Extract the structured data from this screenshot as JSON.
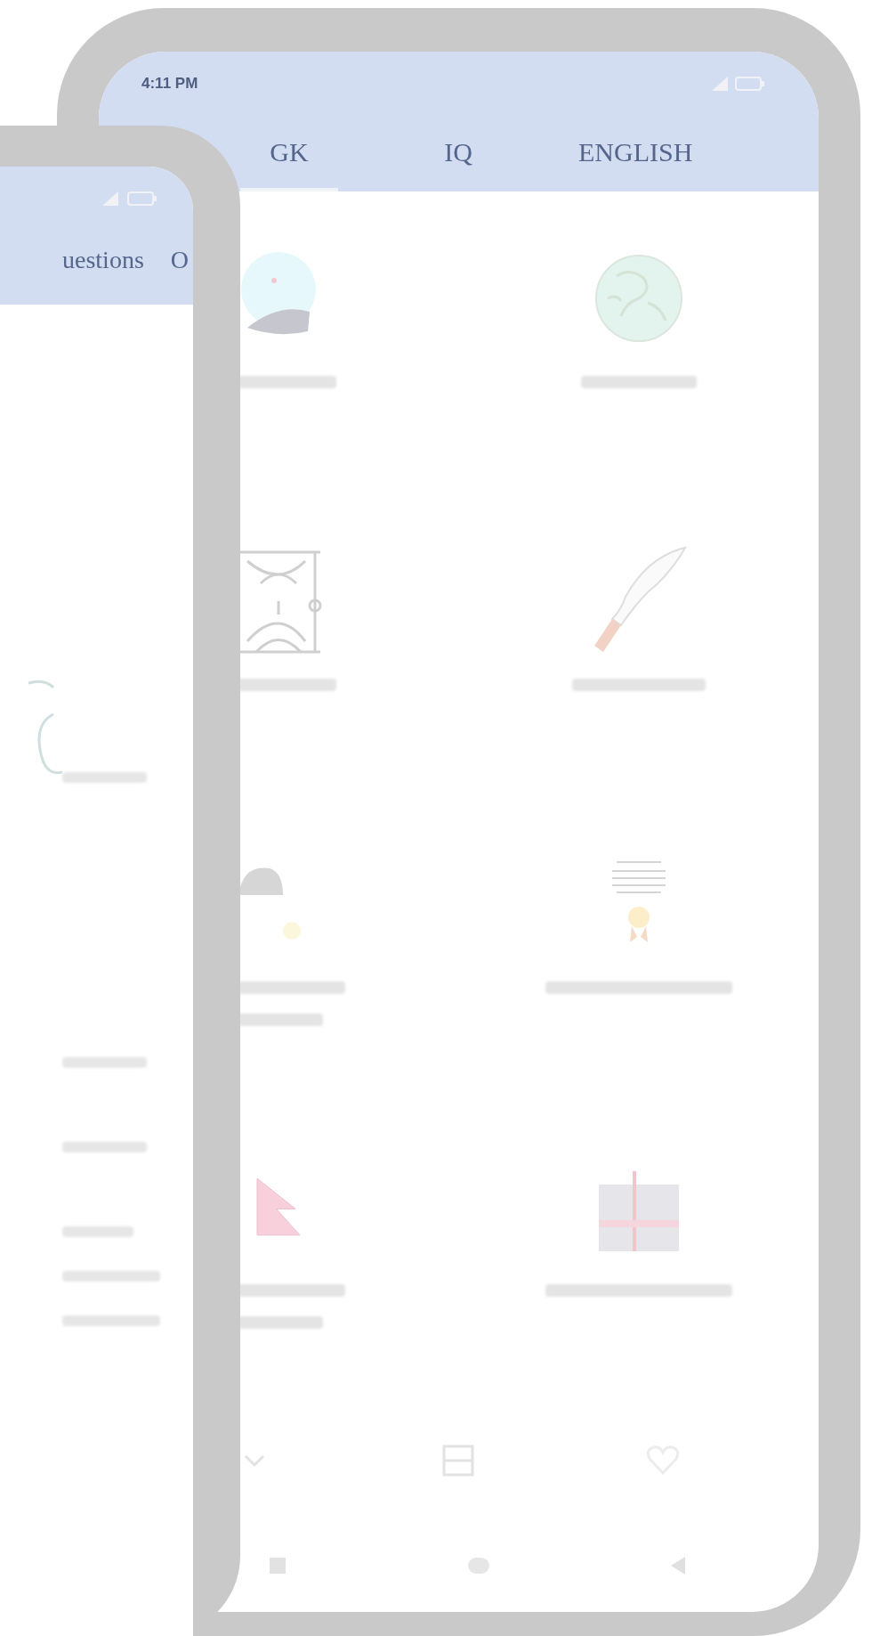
{
  "main_phone": {
    "status_bar": {
      "time": "4:11 PM"
    },
    "tabs": [
      {
        "label": "GK",
        "selected": true
      },
      {
        "label": "IQ",
        "selected": false
      },
      {
        "label": "ENGLISH",
        "selected": false
      }
    ],
    "categories": [
      {
        "kind": "ocean"
      },
      {
        "kind": "globe"
      },
      {
        "kind": "pattern"
      },
      {
        "kind": "kukri"
      },
      {
        "kind": "cap"
      },
      {
        "kind": "certificate"
      },
      {
        "kind": "flag"
      },
      {
        "kind": "chart"
      }
    ]
  },
  "back_phone": {
    "tabs": [
      {
        "label": "uestions",
        "selected": false
      },
      {
        "label": "O",
        "selected": false
      }
    ]
  }
}
